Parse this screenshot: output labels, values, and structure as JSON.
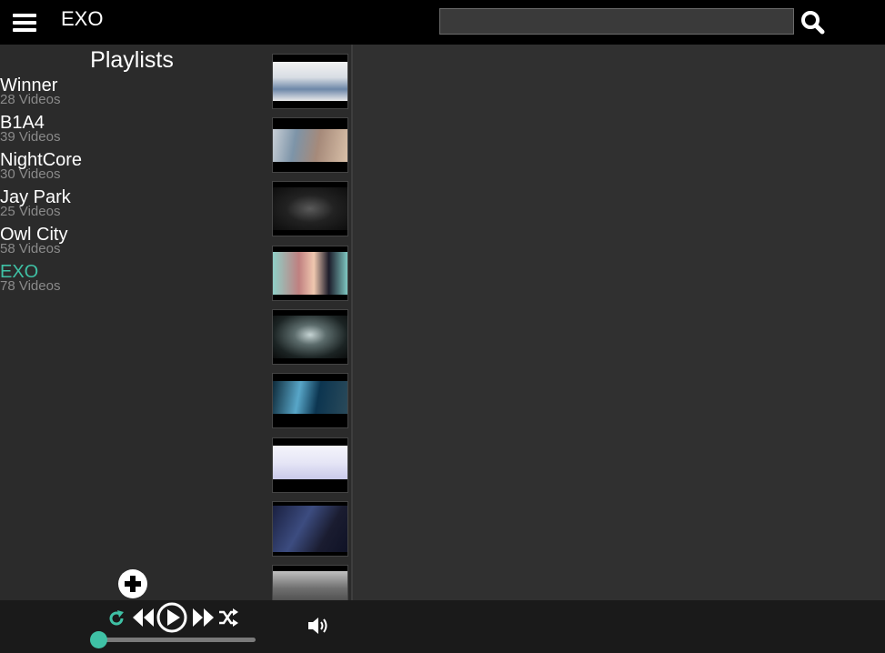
{
  "header": {
    "title": "EXO",
    "search": {
      "value": "",
      "placeholder": ""
    }
  },
  "sidebar": {
    "title": "Playlists",
    "playlists": [
      {
        "name": "Winner",
        "count": "28 Videos",
        "active": false
      },
      {
        "name": "B1A4",
        "count": "39 Videos",
        "active": false
      },
      {
        "name": "NightCore",
        "count": "30 Videos",
        "active": false
      },
      {
        "name": "Jay Park",
        "count": "25 Videos",
        "active": false
      },
      {
        "name": "Owl City",
        "count": "58 Videos",
        "active": false
      },
      {
        "name": "EXO",
        "count": "78 Videos",
        "active": true
      }
    ]
  },
  "player": {
    "progress": 0.0
  },
  "colors": {
    "accent": "#3fc1a5",
    "topbar": "#000000",
    "background": "#2b2b2b",
    "player_bar": "#1a1a1a"
  },
  "icons": [
    "menu-icon",
    "search-icon",
    "plus-circle-icon",
    "repeat-icon",
    "previous-icon",
    "play-icon",
    "next-icon",
    "shuffle-icon",
    "volume-icon"
  ]
}
